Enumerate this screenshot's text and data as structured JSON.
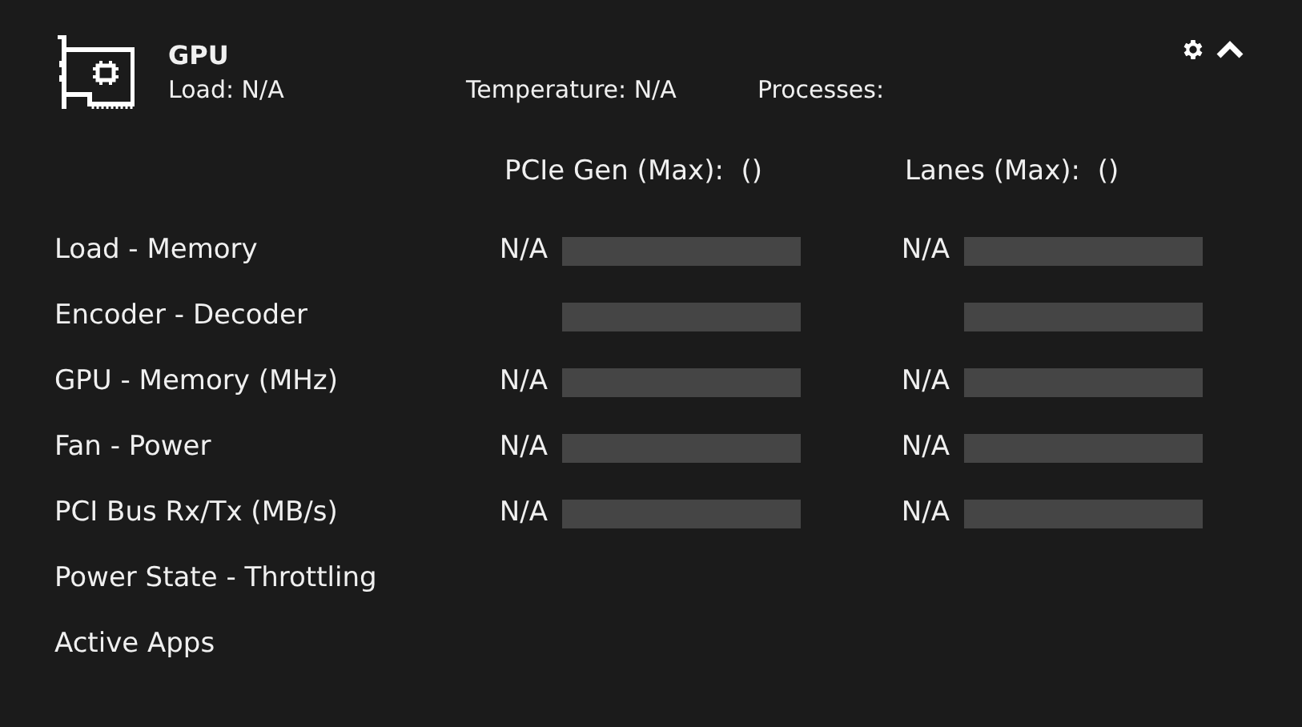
{
  "header": {
    "title": "GPU",
    "load": "Load: N/A",
    "temperature": "Temperature: N/A",
    "processes": "Processes:"
  },
  "columns": [
    "PCIe Gen (Max):  ()",
    "Lanes (Max):  ()"
  ],
  "rows": [
    {
      "label": "Load - Memory",
      "metrics": [
        {
          "reading": "N/A",
          "level": 0
        },
        {
          "reading": "N/A",
          "level": 0
        }
      ]
    },
    {
      "label": "Encoder - Decoder",
      "metrics": [
        {
          "level": 0
        },
        {
          "level": 0
        }
      ]
    },
    {
      "label": "GPU - Memory (MHz)",
      "metrics": [
        {
          "reading": "N/A",
          "level": 0
        },
        {
          "reading": "N/A",
          "level": 0
        }
      ]
    },
    {
      "label": "Fan - Power",
      "metrics": [
        {
          "reading": "N/A",
          "level": 0
        },
        {
          "reading": "N/A",
          "level": 0
        }
      ]
    },
    {
      "label": "PCI Bus Rx/Tx (MB/s)",
      "metrics": [
        {
          "reading": "N/A",
          "level": 0
        },
        {
          "reading": "N/A",
          "level": 0
        }
      ]
    },
    {
      "label": "Power State - Throttling"
    },
    {
      "label": "Active Apps"
    }
  ]
}
